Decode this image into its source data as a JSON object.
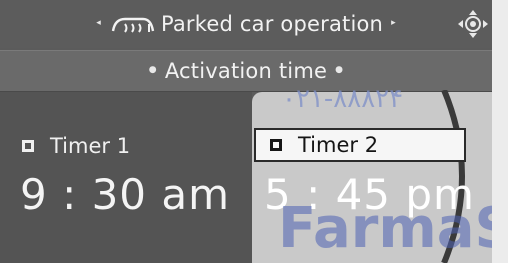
{
  "header": {
    "title": "Parked car operation",
    "title_icon": "heated-seat-icon",
    "controller_icon": "idrive-controller-icon"
  },
  "subheader": {
    "title": "Activation time"
  },
  "timers": [
    {
      "label": "Timer 1",
      "time": "9 : 30 am",
      "selected": false
    },
    {
      "label": "Timer 2",
      "time": "5 : 45 pm",
      "selected": true
    }
  ],
  "watermark": {
    "number": "۰۲۱-۸۸۸۲۴",
    "text": "FarmaS"
  },
  "colors": {
    "screen_bg": "#5b5b5b",
    "selected_panel": "#c9c9c9",
    "watermark": "#4e63b4"
  }
}
